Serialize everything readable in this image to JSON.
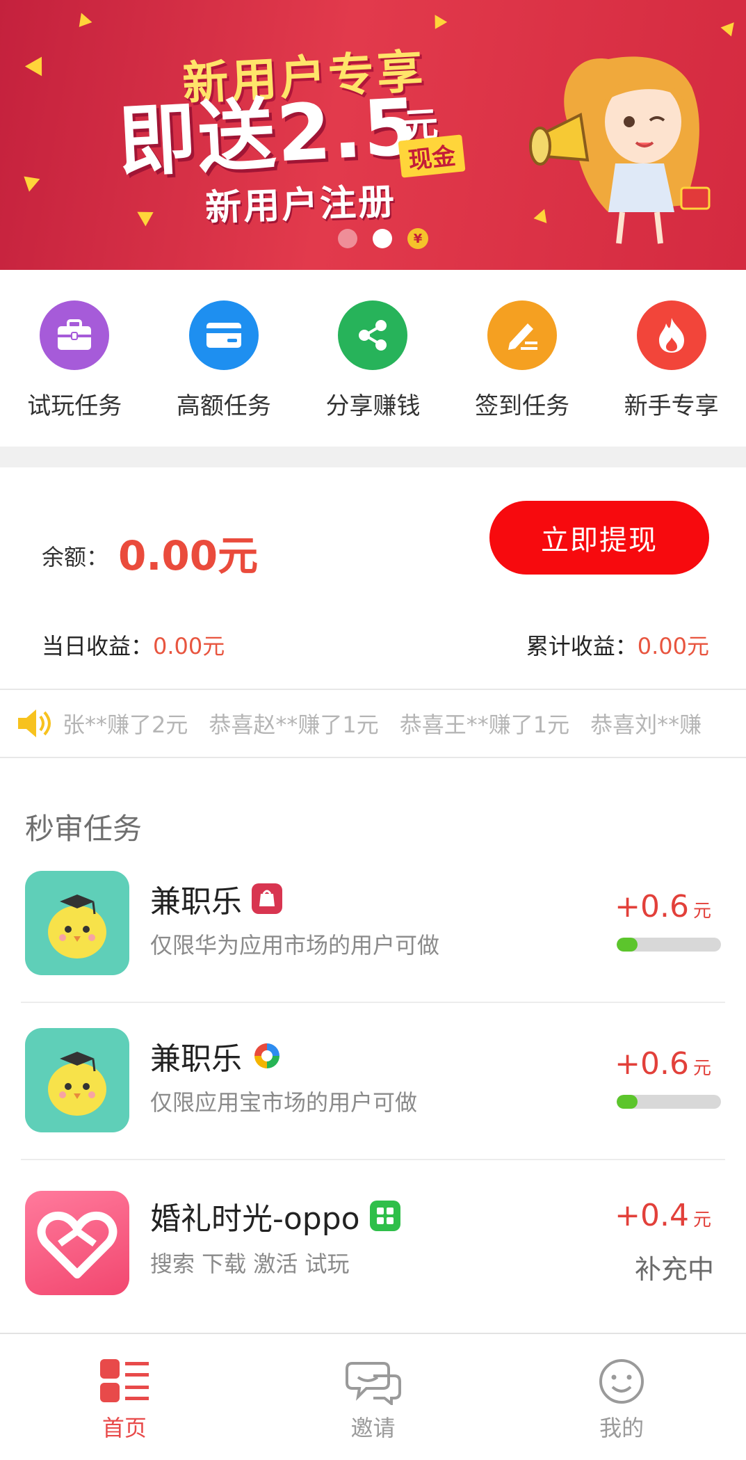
{
  "banner": {
    "line1": "新用户专享",
    "line2_prefix": "即送",
    "line2_amount": "2.5",
    "yuan": "元",
    "cash": "现金",
    "line3": "新用户注册",
    "coin": "¥"
  },
  "quick_menu": [
    {
      "label": "试玩任务",
      "icon": "briefcase-icon",
      "color": "#a65bd9"
    },
    {
      "label": "高额任务",
      "icon": "card-icon",
      "color": "#1e8ff0"
    },
    {
      "label": "分享赚钱",
      "icon": "share-icon",
      "color": "#27b35a"
    },
    {
      "label": "签到任务",
      "icon": "pen-icon",
      "color": "#f5a021"
    },
    {
      "label": "新手专享",
      "icon": "flame-icon",
      "color": "#f2453a"
    }
  ],
  "balance": {
    "label": "余额：",
    "value": "0.00元",
    "withdraw": "立即提现",
    "today_label": "当日收益：",
    "today_value": "0.00元",
    "total_label": "累计收益：",
    "total_value": "0.00元"
  },
  "ticker": [
    "张**赚了2元",
    "恭喜赵**赚了1元",
    "恭喜王**赚了1元",
    "恭喜刘**赚"
  ],
  "section_title": "秒审任务",
  "tasks": [
    {
      "name": "兼职乐",
      "desc": "仅限华为应用市场的用户可做",
      "reward": "+0.6",
      "unit": "元",
      "progress": 0.2,
      "badge": "huawei-store-icon"
    },
    {
      "name": "兼职乐",
      "desc": "仅限应用宝市场的用户可做",
      "reward": "+0.6",
      "unit": "元",
      "progress": 0.2,
      "badge": "yingyongbao-icon"
    },
    {
      "name": "婚礼时光-oppo",
      "desc": "搜索  下载  激活  试玩",
      "reward": "+0.4",
      "unit": "元",
      "status": "补充中",
      "badge": "oppo-store-icon"
    }
  ],
  "tabs": [
    {
      "label": "首页",
      "icon": "home-list-icon",
      "active": true
    },
    {
      "label": "邀请",
      "icon": "chat-bubbles-icon",
      "active": false
    },
    {
      "label": "我的",
      "icon": "smiley-icon",
      "active": false
    }
  ],
  "colors": {
    "accent": "#f70a0e",
    "money": "#e8553f",
    "progress": "#5cc52c"
  }
}
